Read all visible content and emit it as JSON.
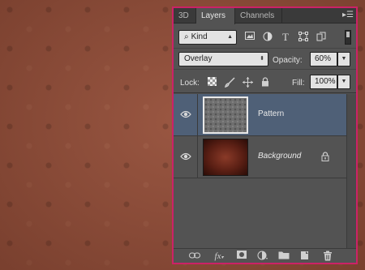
{
  "panel": {
    "tabs": [
      {
        "label": "3D"
      },
      {
        "label": "Layers"
      },
      {
        "label": "Channels"
      }
    ],
    "menu_icon": "panel-menu-icon"
  },
  "filter": {
    "kind_label": "Kind",
    "icons": [
      "image-filter-icon",
      "adjustment-filter-icon",
      "type-filter-icon",
      "shape-filter-icon",
      "smart-object-filter-icon"
    ]
  },
  "blend": {
    "mode": "Overlay",
    "opacity_label": "Opacity:",
    "opacity_value": "60%"
  },
  "lock": {
    "label": "Lock:",
    "fill_label": "Fill:",
    "fill_value": "100%"
  },
  "layers": [
    {
      "name": "Pattern",
      "selected": true,
      "locked": false,
      "visible": true
    },
    {
      "name": "Background",
      "selected": false,
      "locked": true,
      "visible": true
    }
  ],
  "footer_icons": [
    "link-icon",
    "fx-icon",
    "mask-icon",
    "adjustment-icon",
    "folder-icon",
    "new-layer-icon",
    "trash-icon"
  ],
  "colors": {
    "panel_border": "#cc2266",
    "selected_layer": "#4f6077",
    "canvas": "#9a5742"
  }
}
